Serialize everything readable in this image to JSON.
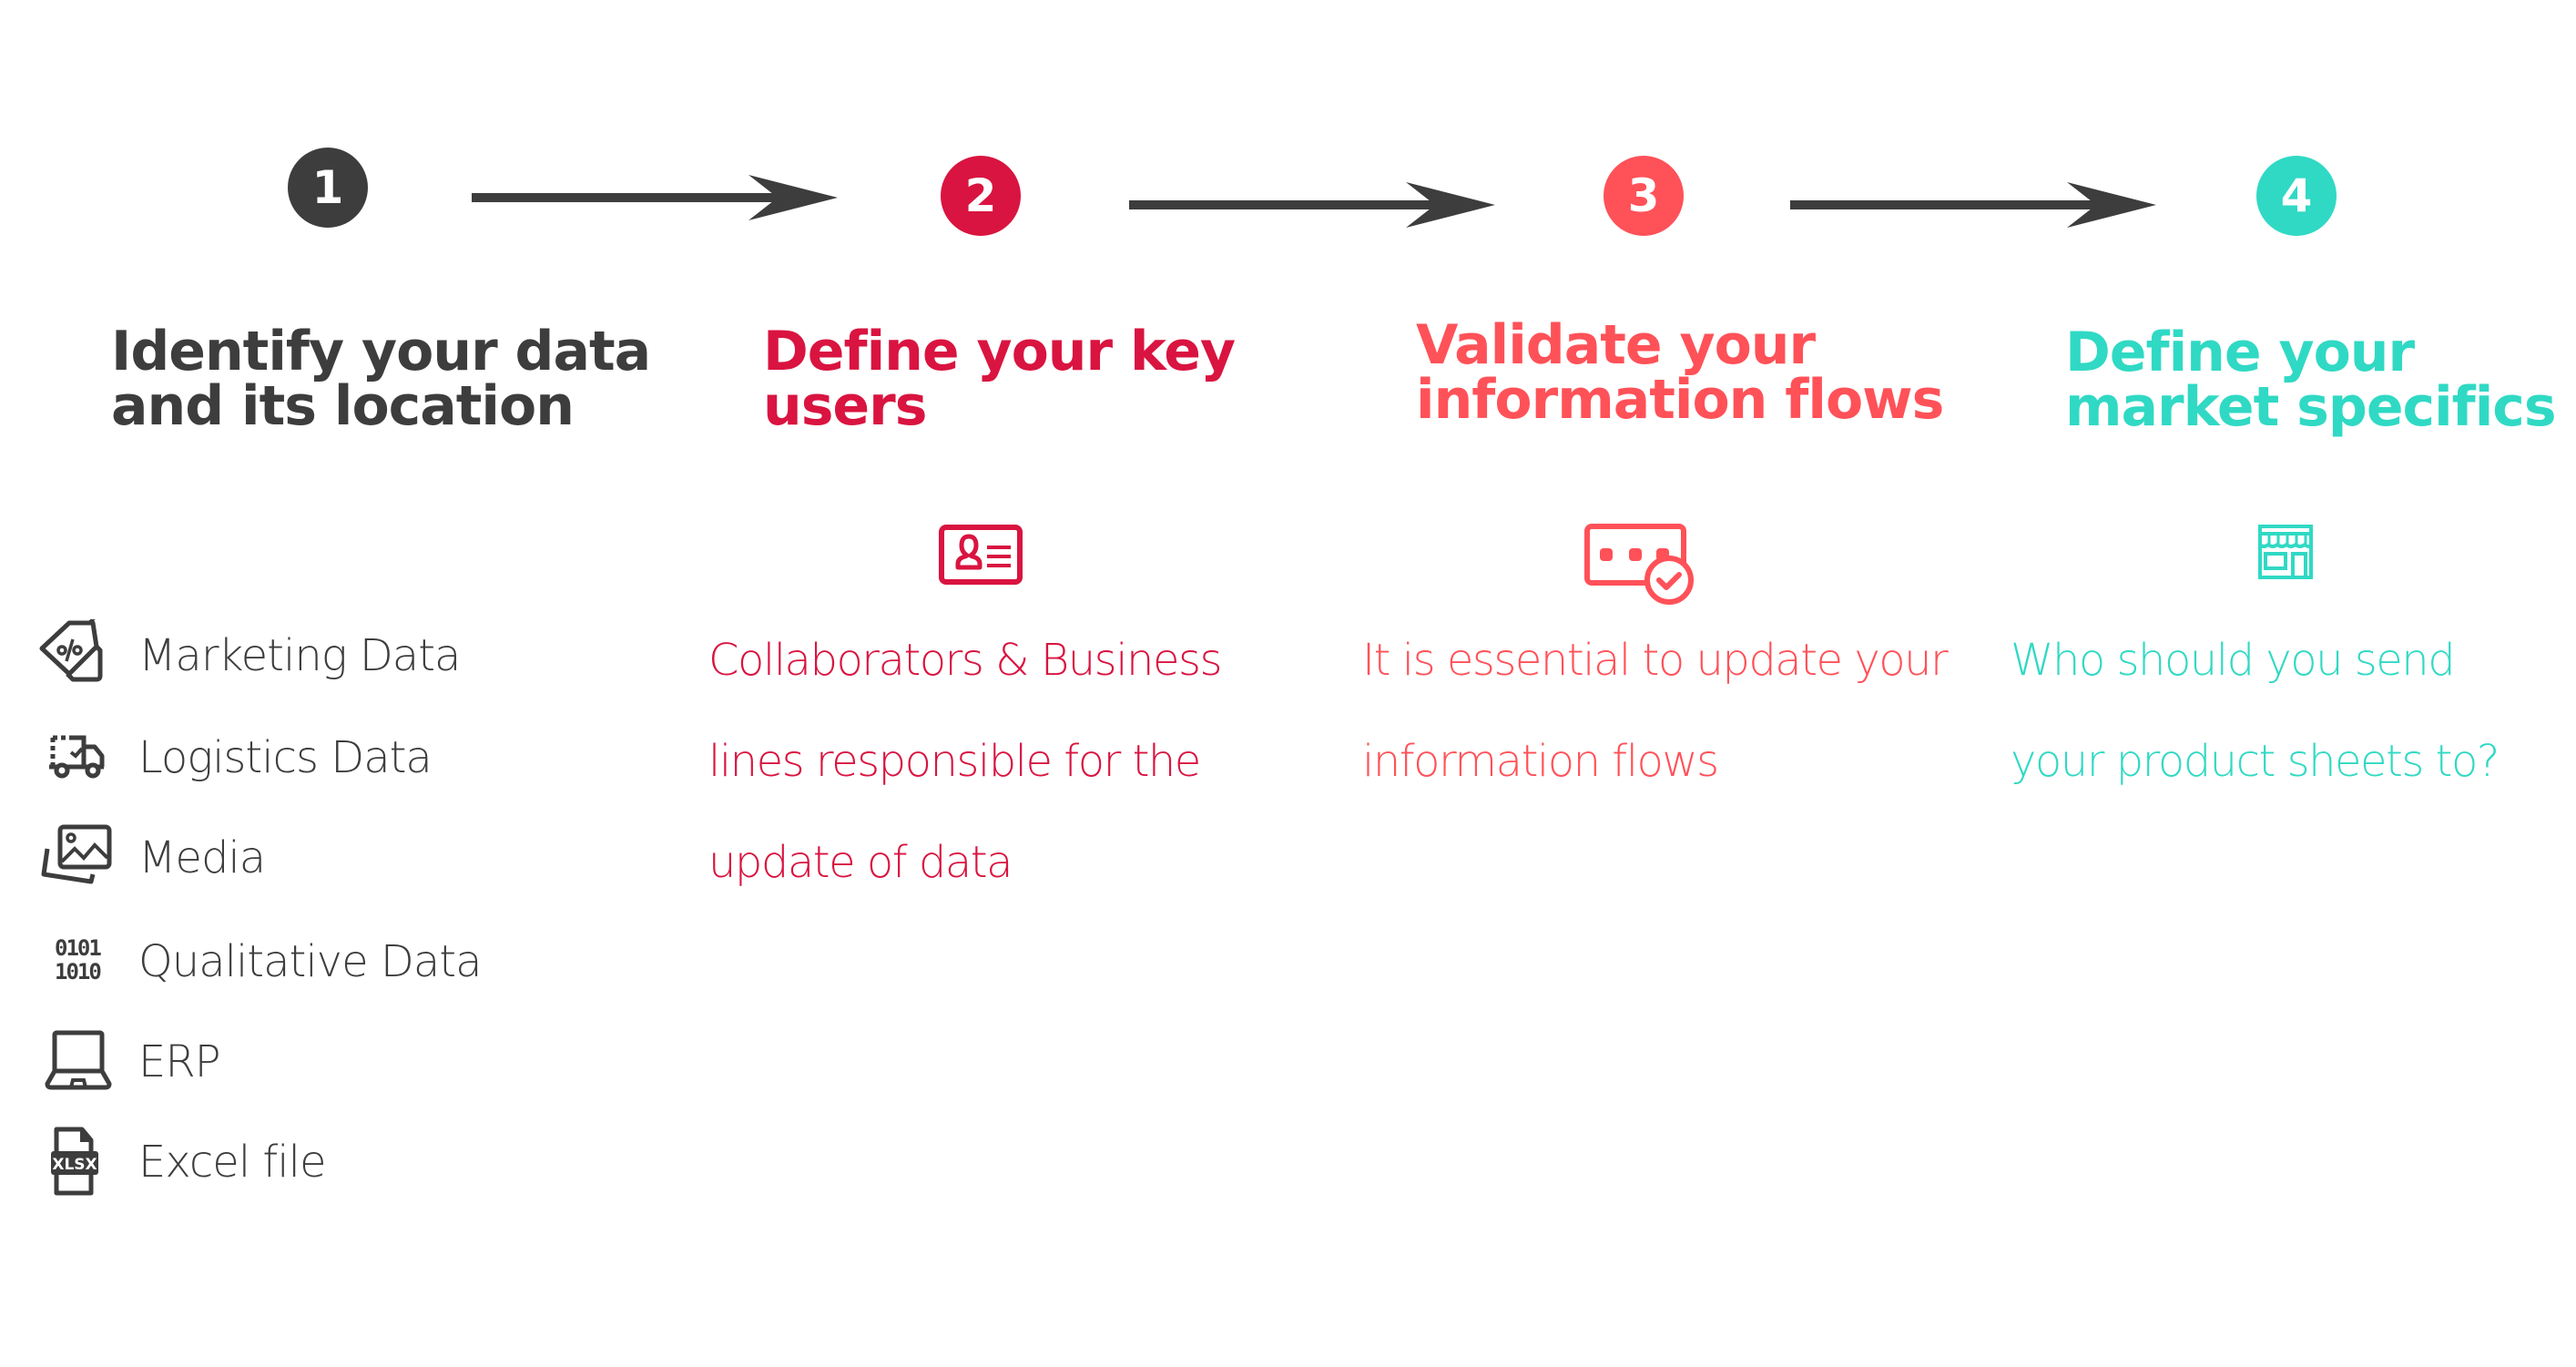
{
  "colors": {
    "step1": "#3d3d3d",
    "step2": "#d91440",
    "step3": "#ff5158",
    "step4": "#30d9c4",
    "arrow": "#3d3d3d"
  },
  "steps": [
    {
      "number": "1",
      "title_lines": [
        "Identify your data",
        "and its location"
      ],
      "icon": null,
      "description_lines": []
    },
    {
      "number": "2",
      "title_lines": [
        "Define your key",
        "users"
      ],
      "icon": "id-card-icon",
      "description_lines": [
        "Collaborators & Business",
        "lines responsible for the",
        "update of data"
      ]
    },
    {
      "number": "3",
      "title_lines": [
        "Validate your",
        "information flows"
      ],
      "icon": "password-check-icon",
      "description_lines": [
        "It is essential to update your",
        "information flows"
      ]
    },
    {
      "number": "4",
      "title_lines": [
        "Define your",
        "market specifics"
      ],
      "icon": "storefront-icon",
      "description_lines": [
        "Who should you send",
        "your product sheets to?"
      ]
    }
  ],
  "data_sources": [
    {
      "label": "Marketing Data",
      "icon": "price-tag-icon"
    },
    {
      "label": "Logistics Data",
      "icon": "delivery-truck-icon"
    },
    {
      "label": "Media",
      "icon": "images-icon"
    },
    {
      "label": "Qualitative Data",
      "icon": "binary-icon"
    },
    {
      "label": "ERP",
      "icon": "laptop-icon"
    },
    {
      "label": "Excel file",
      "icon": "xlsx-file-icon"
    }
  ],
  "xlsx_badge": "XLSX",
  "binary_rows": [
    "0101",
    "1010"
  ]
}
